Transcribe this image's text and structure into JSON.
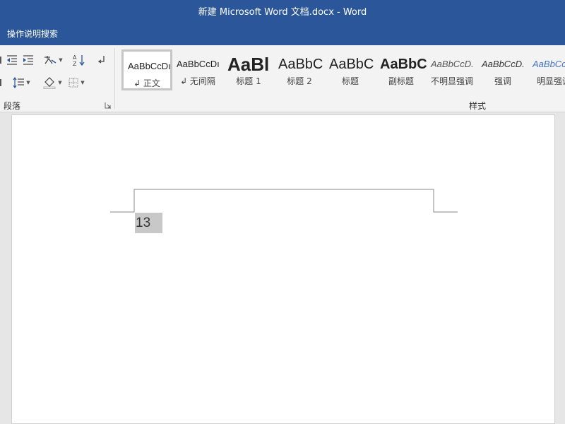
{
  "window": {
    "title": "新建 Microsoft Word 文档.docx  -  Word"
  },
  "tell_me": {
    "label": "操作说明搜索"
  },
  "paragraph_group": {
    "label": "段落",
    "icons": [
      "decrease-indent-icon",
      "increase-indent-icon",
      "chinese-layout-icon",
      "sort-icon",
      "show-formatting-marks-icon",
      "line-spacing-icon",
      "shading-icon",
      "borders-icon",
      "dialog-launcher-icon"
    ]
  },
  "styles_group": {
    "label": "样式",
    "items": [
      {
        "preview": "AaBbCcDı",
        "name": "↲ 正文",
        "selected": true
      },
      {
        "preview": "AaBbCcDı",
        "name": "↲ 无间隔"
      },
      {
        "preview": "AaBl",
        "name": "标题 1"
      },
      {
        "preview": "AaBbC",
        "name": "标题 2"
      },
      {
        "preview": "AaBbC",
        "name": "标题"
      },
      {
        "preview": "AaBbC",
        "name": "副标题"
      },
      {
        "preview": "AaBbCcD.",
        "name": "不明显强调"
      },
      {
        "preview": "AaBbCcD.",
        "name": "强调"
      },
      {
        "preview": "AaBbCc",
        "name": "明显强调"
      }
    ]
  },
  "document": {
    "page_number": "13"
  },
  "colors": {
    "title_bar": "#2b579a",
    "ribbon": "#f3f3f3",
    "page_number_highlight": "#c8c8c8"
  }
}
